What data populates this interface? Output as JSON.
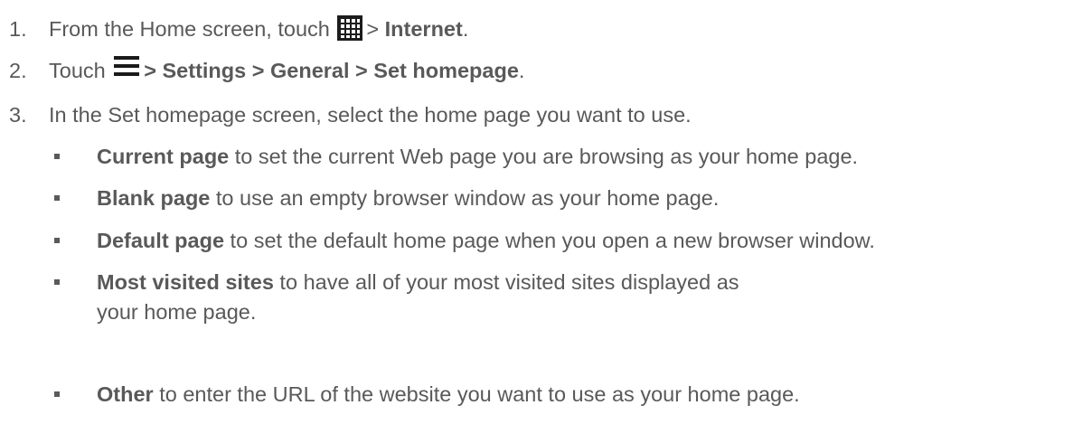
{
  "steps": [
    {
      "number": "1.",
      "pre": "From the Home screen, touch",
      "icon": "apps-grid-icon",
      "post": "> ",
      "bold": "Internet",
      "tail": "."
    },
    {
      "number": "2.",
      "pre": "Touch",
      "icon": "menu-icon",
      "bold": "> Settings > General > Set homepage",
      "tail": "."
    },
    {
      "number": "3.",
      "text": "In the Set homepage screen, select the home page you want to use."
    }
  ],
  "options": [
    {
      "bold": "Current page",
      "text": " to set the current Web page you are browsing as your home page."
    },
    {
      "bold": "Blank page",
      "text": " to use an empty browser window as your home page."
    },
    {
      "bold": "Default page",
      "text": " to set the default home page when you open a new browser window."
    },
    {
      "bold": "Most visited sites",
      "text": " to have all of your most visited sites displayed as your home page."
    },
    {
      "bold": "Other",
      "text": " to enter the URL of the website you want to use as your home page."
    }
  ]
}
